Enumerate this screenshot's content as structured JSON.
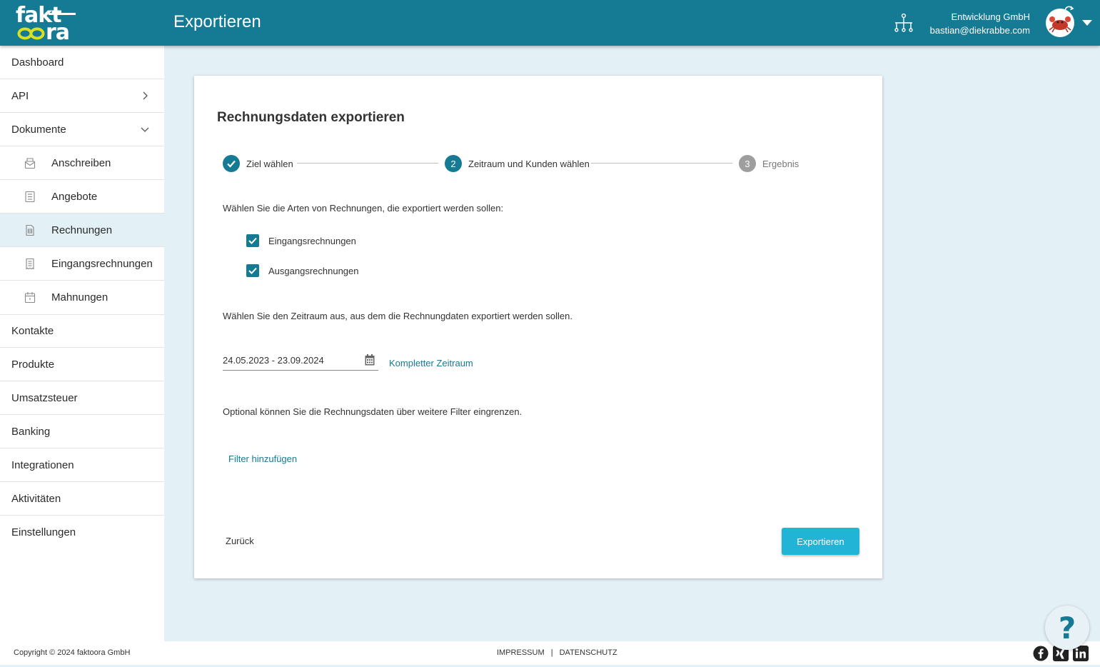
{
  "header": {
    "logo_line1": "fakt",
    "logo_line2": "ra",
    "title": "Exportieren",
    "company": "Entwicklung GmbH",
    "email": "bastian@diekrabbe.com"
  },
  "sidebar": {
    "items": [
      {
        "label": "Dashboard"
      },
      {
        "label": "API"
      },
      {
        "label": "Dokumente"
      },
      {
        "label": "Anschreiben"
      },
      {
        "label": "Angebote"
      },
      {
        "label": "Rechnungen"
      },
      {
        "label": "Eingangsrechnungen"
      },
      {
        "label": "Mahnungen"
      },
      {
        "label": "Kontakte"
      },
      {
        "label": "Produkte"
      },
      {
        "label": "Umsatzsteuer"
      },
      {
        "label": "Banking"
      },
      {
        "label": "Integrationen"
      },
      {
        "label": "Aktivitäten"
      },
      {
        "label": "Einstellungen"
      }
    ]
  },
  "card": {
    "title": "Rechnungsdaten exportieren",
    "steps": [
      {
        "number": "",
        "label": "Ziel wählen"
      },
      {
        "number": "2",
        "label": "Zeitraum und Kunden wählen"
      },
      {
        "number": "3",
        "label": "Ergebnis"
      }
    ],
    "types_prompt": "Wählen Sie die Arten von Rechnungen, die exportiert werden sollen:",
    "checkboxes": [
      {
        "label": "Eingangsrechnungen",
        "checked": true
      },
      {
        "label": "Ausgangsrechnungen",
        "checked": true
      }
    ],
    "period_prompt": "Wählen Sie den Zeitraum aus, aus dem die Rechnungdaten exportiert werden sollen.",
    "date_range": "24.05.2023 - 23.09.2024",
    "full_period_link": "Kompletter Zeitraum",
    "filter_prompt": "Optional können Sie die Rechnungsdaten über weitere Filter eingrenzen.",
    "add_filter_link": "Filter hinzufügen",
    "back_button": "Zurück",
    "export_button": "Exportieren"
  },
  "help": {
    "symbol": "?"
  },
  "footer": {
    "copyright": "Copyright © 2024 faktoora GmbH",
    "impressum": "IMPRESSUM",
    "separator": "|",
    "datenschutz": "DATENSCHUTZ"
  },
  "colors": {
    "primary": "#157a94",
    "accent": "#21b4d6",
    "background": "#e3f0f6"
  }
}
